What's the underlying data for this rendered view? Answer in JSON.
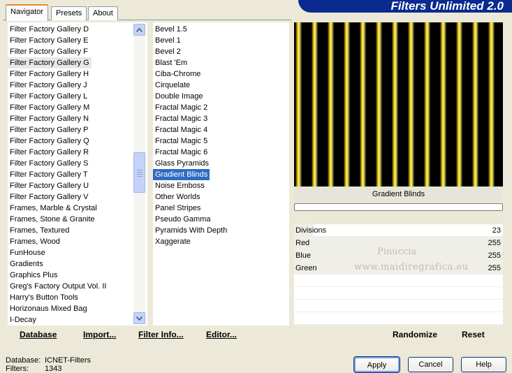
{
  "banner": {
    "title": "Filters Unlimited 2.0"
  },
  "tabs": [
    {
      "label": "Navigator",
      "active": true
    },
    {
      "label": "Presets",
      "active": false
    },
    {
      "label": "About",
      "active": false
    }
  ],
  "categories": {
    "items": [
      "Filter Factory Gallery D",
      "Filter Factory Gallery E",
      "Filter Factory Gallery F",
      "Filter Factory Gallery G",
      "Filter Factory Gallery H",
      "Filter Factory Gallery J",
      "Filter Factory Gallery L",
      "Filter Factory Gallery M",
      "Filter Factory Gallery N",
      "Filter Factory Gallery P",
      "Filter Factory Gallery Q",
      "Filter Factory Gallery R",
      "Filter Factory Gallery S",
      "Filter Factory Gallery T",
      "Filter Factory Gallery U",
      "Filter Factory Gallery V",
      "Frames, Marble & Crystal",
      "Frames, Stone & Granite",
      "Frames, Textured",
      "Frames, Wood",
      "FunHouse",
      "Gradients",
      "Graphics Plus",
      "Greg's Factory Output Vol. II",
      "Harry's Button Tools",
      "Horizonaus Mixed Bag",
      "I-Decay"
    ],
    "selected": "Filter Factory Gallery G"
  },
  "filters": {
    "items": [
      "Bevel 1.5",
      "Bevel 1",
      "Bevel 2",
      "Blast 'Em",
      "Ciba-Chrome",
      "Cirquelate",
      "Double Image",
      "Fractal Magic 2",
      "Fractal Magic 3",
      "Fractal Magic 4",
      "Fractal Magic 5",
      "Fractal Magic 6",
      "Glass Pyramids",
      "Gradient Blinds",
      "Noise Emboss",
      "Other Worlds",
      "Panel Stripes",
      "Pseudo Gamma",
      "Pyramids With Depth",
      "Xaggerate"
    ],
    "selected": "Gradient Blinds"
  },
  "preview": {
    "filter_name": "Gradient Blinds",
    "stripe_count": 13,
    "stripe_color": "#f2d500",
    "background_color": "#000000"
  },
  "params": [
    {
      "label": "Divisions",
      "value": "23",
      "level": 0.09
    },
    {
      "label": "Red",
      "value": "255",
      "level": 1.0
    },
    {
      "label": "Blue",
      "value": "255",
      "level": 1.0
    },
    {
      "label": "Green",
      "value": "255",
      "level": 1.0
    }
  ],
  "watermark": {
    "line1": "Pinuccia",
    "line2": "www.maidiregrafica.eu"
  },
  "bottom_left_buttons": [
    "Database",
    "Import...",
    "Filter Info...",
    "Editor..."
  ],
  "bottom_right_buttons": [
    "Randomize",
    "Reset"
  ],
  "footer": {
    "database_label": "Database:",
    "database_value": "ICNET-Filters",
    "filters_label": "Filters:",
    "filters_value": "1343"
  },
  "dialog_buttons": {
    "apply": "Apply",
    "cancel": "Cancel",
    "help": "Help"
  }
}
